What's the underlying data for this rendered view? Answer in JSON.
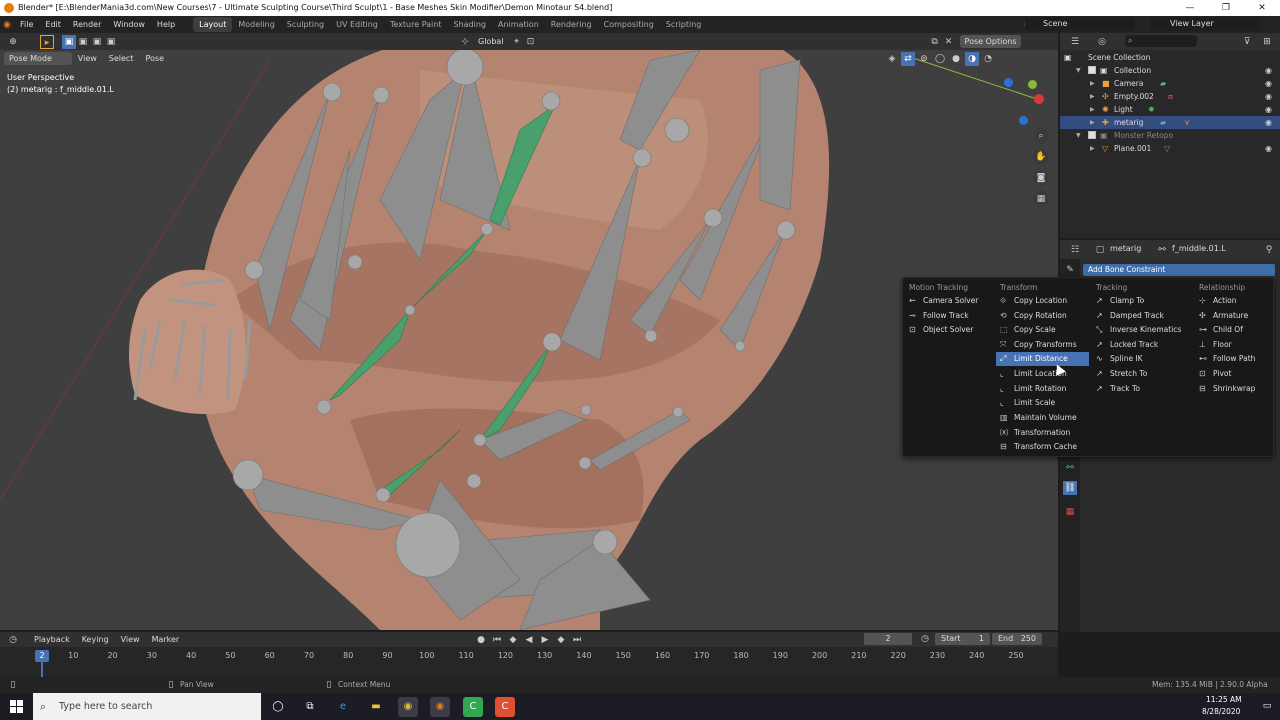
{
  "window": {
    "title": "Blender* [E:\\BlenderMania3d.com\\New Courses\\7 - Ultimate Sculpting Course\\Third Sculpt\\1 - Base Meshes Skin Modifier\\Demon Minotaur S4.blend]",
    "controls": [
      "—",
      "❐",
      "✕"
    ]
  },
  "menu": {
    "items": [
      "File",
      "Edit",
      "Render",
      "Window",
      "Help"
    ],
    "workspaces": [
      "Layout",
      "Modeling",
      "Sculpting",
      "UV Editing",
      "Texture Paint",
      "Shading",
      "Animation",
      "Rendering",
      "Compositing",
      "Scripting"
    ],
    "active_workspace": "Layout",
    "scene": "Scene",
    "view_layer": "View Layer"
  },
  "viewport": {
    "header": {
      "transform": "Global",
      "options": "Pose Options"
    },
    "header2": {
      "mode": "Pose Mode",
      "menus": [
        "View",
        "Select",
        "Pose"
      ]
    },
    "info_line1": "User Perspective",
    "info_line2": "(2) metarig : f_middle.01.L",
    "accent": "#5ea567"
  },
  "outliner": {
    "search_placeholder": "",
    "rows": [
      {
        "label": "Scene Collection",
        "icon": "scene-collection-icon",
        "indent": 0
      },
      {
        "label": "Collection",
        "icon": "collection-icon",
        "indent": 1,
        "checked": true
      },
      {
        "label": "Camera",
        "icon": "camera-icon",
        "indent": 2
      },
      {
        "label": "Empty.002",
        "icon": "empty-icon",
        "indent": 2
      },
      {
        "label": "Light",
        "icon": "light-icon",
        "indent": 2
      },
      {
        "label": "metarig",
        "icon": "armature-icon",
        "indent": 2,
        "selected": true
      },
      {
        "label": "Monster Retopo",
        "icon": "collection-icon",
        "indent": 1,
        "checked": true
      },
      {
        "label": "Plane.001",
        "icon": "mesh-icon",
        "indent": 2
      }
    ]
  },
  "properties": {
    "object": "metarig",
    "bone": "f_middle.01.L",
    "add_constraint": "Add Bone Constraint"
  },
  "constraint_menu": {
    "columns": [
      {
        "title": "Motion Tracking",
        "items": [
          "Camera Solver",
          "Follow Track",
          "Object Solver"
        ]
      },
      {
        "title": "Transform",
        "items": [
          "Copy Location",
          "Copy Rotation",
          "Copy Scale",
          "Copy Transforms",
          "Limit Distance",
          "Limit Location",
          "Limit Rotation",
          "Limit Scale",
          "Maintain Volume",
          "Transformation",
          "Transform Cache"
        ]
      },
      {
        "title": "Tracking",
        "items": [
          "Clamp To",
          "Damped Track",
          "Inverse Kinematics",
          "Locked Track",
          "Spline IK",
          "Stretch To",
          "Track To"
        ]
      },
      {
        "title": "Relationship",
        "items": [
          "Action",
          "Armature",
          "Child Of",
          "Floor",
          "Follow Path",
          "Pivot",
          "Shrinkwrap"
        ]
      }
    ],
    "highlighted": "Limit Distance",
    "highlight_color": "#4772b3"
  },
  "timeline": {
    "menus": [
      "Playback",
      "Keying",
      "View",
      "Marker"
    ],
    "current_frame": "2",
    "frame_field": "2",
    "start_label": "Start",
    "start": "1",
    "end_label": "End",
    "end": "250",
    "ticks": [
      "10",
      "20",
      "30",
      "40",
      "50",
      "60",
      "70",
      "80",
      "90",
      "100",
      "110",
      "120",
      "130",
      "140",
      "150",
      "160",
      "170",
      "180",
      "190",
      "200",
      "210",
      "220",
      "230",
      "240",
      "250"
    ]
  },
  "status": {
    "pan": "Pan View",
    "context": "Context Menu",
    "memory": "Mem: 135.4 MiB | 2.90.0 Alpha"
  },
  "taskbar": {
    "search_placeholder": "Type here to search",
    "time": "11:25 AM",
    "date": "8/28/2020"
  }
}
